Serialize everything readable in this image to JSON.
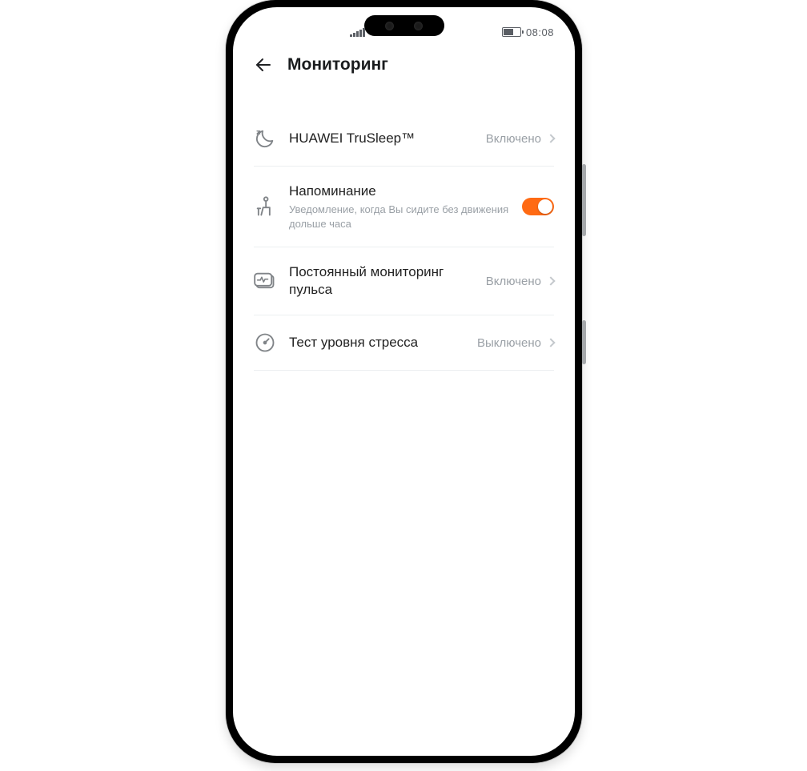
{
  "statusbar": {
    "time": "08:08"
  },
  "header": {
    "title": "Мониторинг"
  },
  "accent_color": "#ff6a13",
  "list": [
    {
      "id": "trusleep",
      "title": "HUAWEI TruSleep™",
      "value": "Включено"
    },
    {
      "id": "reminder",
      "title": "Напоминание",
      "subtitle": "Уведомление, когда Вы сидите без движения дольше часа",
      "toggle": true
    },
    {
      "id": "heartrate",
      "title": "Постоянный мониторинг пульса",
      "value": "Включено"
    },
    {
      "id": "stress",
      "title": "Тест уровня стресса",
      "value": "Выключено"
    }
  ]
}
